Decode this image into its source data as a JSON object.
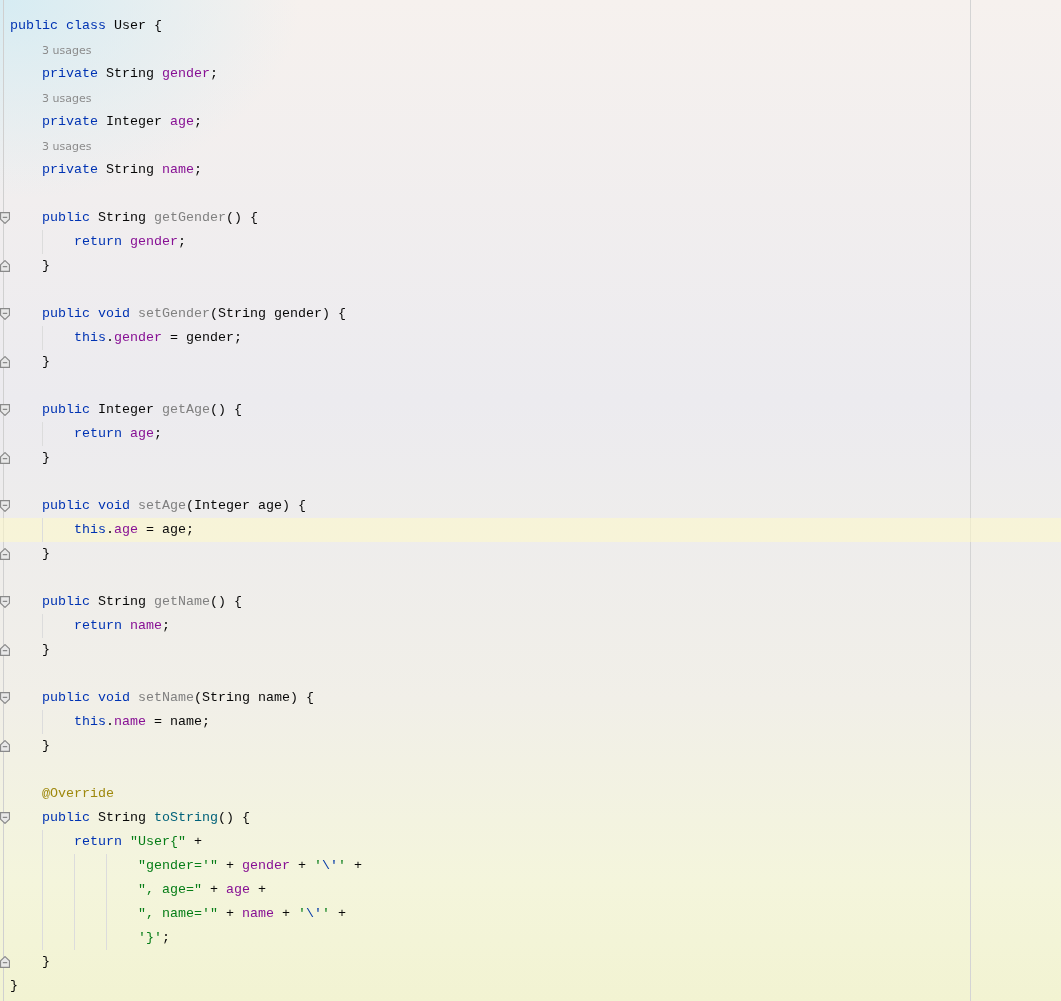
{
  "lines": [
    {
      "kind": "code",
      "tokens": [
        {
          "kind": "kw",
          "text": "public class"
        },
        {
          "kind": "plain",
          "text": " User {"
        }
      ],
      "children": [
        {
          "kind": "hint",
          "text": "3 usages"
        },
        {
          "kind": "code",
          "tokens": [
            {
              "kind": "kw",
              "text": "private"
            },
            {
              "kind": "plain",
              "text": " String "
            },
            {
              "kind": "fld",
              "text": "gender"
            },
            {
              "kind": "plain",
              "text": ";"
            }
          ]
        },
        {
          "kind": "hint",
          "text": "3 usages"
        },
        {
          "kind": "code",
          "tokens": [
            {
              "kind": "kw",
              "text": "private"
            },
            {
              "kind": "plain",
              "text": " Integer "
            },
            {
              "kind": "fld",
              "text": "age"
            },
            {
              "kind": "plain",
              "text": ";"
            }
          ]
        },
        {
          "kind": "hint",
          "text": "3 usages"
        },
        {
          "kind": "code",
          "tokens": [
            {
              "kind": "kw",
              "text": "private"
            },
            {
              "kind": "plain",
              "text": " String "
            },
            {
              "kind": "fld",
              "text": "name"
            },
            {
              "kind": "plain",
              "text": ";"
            }
          ]
        },
        {
          "kind": "blank"
        },
        {
          "kind": "code",
          "fold": true,
          "tokens": [
            {
              "kind": "kw",
              "text": "public"
            },
            {
              "kind": "plain",
              "text": " String "
            },
            {
              "kind": "unused",
              "text": "getGender"
            },
            {
              "kind": "plain",
              "text": "() {"
            }
          ],
          "children": [
            {
              "kind": "code",
              "tokens": [
                {
                  "kind": "kw",
                  "text": "return "
                },
                {
                  "kind": "fld",
                  "text": "gender"
                },
                {
                  "kind": "plain",
                  "text": ";"
                }
              ]
            }
          ]
        },
        {
          "kind": "code",
          "fold": true,
          "tokens": [
            {
              "kind": "plain",
              "text": "}"
            }
          ]
        },
        {
          "kind": "blank"
        },
        {
          "kind": "code",
          "fold": true,
          "tokens": [
            {
              "kind": "kw",
              "text": "public void "
            },
            {
              "kind": "unused",
              "text": "setGender"
            },
            {
              "kind": "plain",
              "text": "(String gender) {"
            }
          ],
          "children": [
            {
              "kind": "code",
              "tokens": [
                {
                  "kind": "kw",
                  "text": "this"
                },
                {
                  "kind": "plain",
                  "text": "."
                },
                {
                  "kind": "fld",
                  "text": "gender"
                },
                {
                  "kind": "plain",
                  "text": " = gender;"
                }
              ]
            }
          ]
        },
        {
          "kind": "code",
          "fold": true,
          "tokens": [
            {
              "kind": "plain",
              "text": "}"
            }
          ]
        },
        {
          "kind": "blank"
        },
        {
          "kind": "code",
          "fold": true,
          "tokens": [
            {
              "kind": "kw",
              "text": "public"
            },
            {
              "kind": "plain",
              "text": " Integer "
            },
            {
              "kind": "unused",
              "text": "getAge"
            },
            {
              "kind": "plain",
              "text": "() {"
            }
          ],
          "children": [
            {
              "kind": "code",
              "tokens": [
                {
                  "kind": "kw",
                  "text": "return "
                },
                {
                  "kind": "fld",
                  "text": "age"
                },
                {
                  "kind": "plain",
                  "text": ";"
                }
              ]
            }
          ]
        },
        {
          "kind": "code",
          "fold": true,
          "tokens": [
            {
              "kind": "plain",
              "text": "}"
            }
          ]
        },
        {
          "kind": "blank"
        },
        {
          "kind": "code",
          "fold": true,
          "tokens": [
            {
              "kind": "kw",
              "text": "public void "
            },
            {
              "kind": "unused",
              "text": "setAge"
            },
            {
              "kind": "plain",
              "text": "(Integer age) {"
            }
          ],
          "children": [
            {
              "kind": "code",
              "current": true,
              "tokens": [
                {
                  "kind": "kw",
                  "text": "this"
                },
                {
                  "kind": "plain",
                  "text": "."
                },
                {
                  "kind": "fld",
                  "text": "age"
                },
                {
                  "kind": "plain",
                  "text": " = age;"
                }
              ]
            }
          ]
        },
        {
          "kind": "code",
          "fold": true,
          "tokens": [
            {
              "kind": "plain",
              "text": "}"
            }
          ]
        },
        {
          "kind": "blank"
        },
        {
          "kind": "code",
          "fold": true,
          "tokens": [
            {
              "kind": "kw",
              "text": "public"
            },
            {
              "kind": "plain",
              "text": " String "
            },
            {
              "kind": "unused",
              "text": "getName"
            },
            {
              "kind": "plain",
              "text": "() {"
            }
          ],
          "children": [
            {
              "kind": "code",
              "tokens": [
                {
                  "kind": "kw",
                  "text": "return "
                },
                {
                  "kind": "fld",
                  "text": "name"
                },
                {
                  "kind": "plain",
                  "text": ";"
                }
              ]
            }
          ]
        },
        {
          "kind": "code",
          "fold": true,
          "tokens": [
            {
              "kind": "plain",
              "text": "}"
            }
          ]
        },
        {
          "kind": "blank"
        },
        {
          "kind": "code",
          "fold": true,
          "tokens": [
            {
              "kind": "kw",
              "text": "public void "
            },
            {
              "kind": "unused",
              "text": "setName"
            },
            {
              "kind": "plain",
              "text": "(String name) {"
            }
          ],
          "children": [
            {
              "kind": "code",
              "tokens": [
                {
                  "kind": "kw",
                  "text": "this"
                },
                {
                  "kind": "plain",
                  "text": "."
                },
                {
                  "kind": "fld",
                  "text": "name"
                },
                {
                  "kind": "plain",
                  "text": " = name;"
                }
              ]
            }
          ]
        },
        {
          "kind": "code",
          "fold": true,
          "tokens": [
            {
              "kind": "plain",
              "text": "}"
            }
          ]
        },
        {
          "kind": "blank"
        },
        {
          "kind": "code",
          "tokens": [
            {
              "kind": "ann",
              "text": "@Override"
            }
          ]
        },
        {
          "kind": "code",
          "fold": true,
          "tokens": [
            {
              "kind": "kw",
              "text": "public"
            },
            {
              "kind": "plain",
              "text": " String "
            },
            {
              "kind": "method",
              "text": "toString"
            },
            {
              "kind": "plain",
              "text": "() {"
            }
          ],
          "children": [
            {
              "kind": "code",
              "tokens": [
                {
                  "kind": "kw",
                  "text": "return "
                },
                {
                  "kind": "str",
                  "text": "\"User{\""
                },
                {
                  "kind": "plain",
                  "text": " +"
                }
              ],
              "children": [
                {
                  "kind": "continuation",
                  "tokens": [
                    {
                      "kind": "str",
                      "text": "\"gender='\""
                    },
                    {
                      "kind": "plain",
                      "text": " + "
                    },
                    {
                      "kind": "fld",
                      "text": "gender"
                    },
                    {
                      "kind": "plain",
                      "text": " + "
                    },
                    {
                      "kind": "str",
                      "text": "'"
                    },
                    {
                      "kind": "esc",
                      "text": "\\'"
                    },
                    {
                      "kind": "str",
                      "text": "'"
                    },
                    {
                      "kind": "plain",
                      "text": " +"
                    }
                  ]
                },
                {
                  "kind": "continuation",
                  "tokens": [
                    {
                      "kind": "str",
                      "text": "\", age=\""
                    },
                    {
                      "kind": "plain",
                      "text": " + "
                    },
                    {
                      "kind": "fld",
                      "text": "age"
                    },
                    {
                      "kind": "plain",
                      "text": " +"
                    }
                  ]
                },
                {
                  "kind": "continuation",
                  "tokens": [
                    {
                      "kind": "str",
                      "text": "\", name='\""
                    },
                    {
                      "kind": "plain",
                      "text": " + "
                    },
                    {
                      "kind": "fld",
                      "text": "name"
                    },
                    {
                      "kind": "plain",
                      "text": " + "
                    },
                    {
                      "kind": "str",
                      "text": "'"
                    },
                    {
                      "kind": "esc",
                      "text": "\\'"
                    },
                    {
                      "kind": "str",
                      "text": "'"
                    },
                    {
                      "kind": "plain",
                      "text": " +"
                    }
                  ]
                },
                {
                  "kind": "continuation",
                  "tokens": [
                    {
                      "kind": "str",
                      "text": "'}'"
                    },
                    {
                      "kind": "plain",
                      "text": ";"
                    }
                  ]
                }
              ]
            }
          ]
        },
        {
          "kind": "code",
          "fold": true,
          "tokens": [
            {
              "kind": "plain",
              "text": "}"
            }
          ]
        }
      ]
    },
    {
      "kind": "code",
      "tokens": [
        {
          "kind": "plain",
          "text": "}"
        }
      ]
    }
  ]
}
